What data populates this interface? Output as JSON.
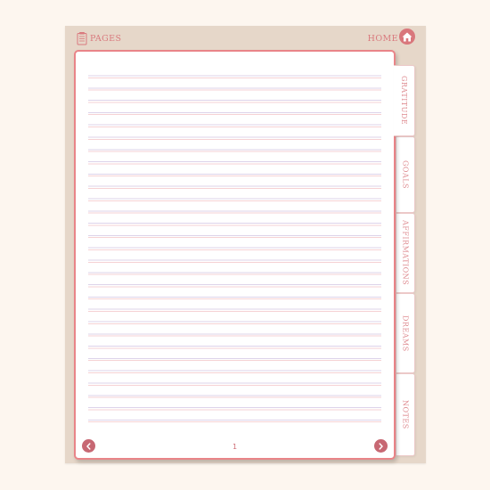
{
  "header": {
    "pages_label": "PAGES",
    "home_label": "HOME"
  },
  "page": {
    "number": "1"
  },
  "tabs": [
    {
      "label": "GRATITUDE",
      "active": true
    },
    {
      "label": "GOALS",
      "active": false
    },
    {
      "label": "AFFIRMATIONS",
      "active": false
    },
    {
      "label": "DREAMS",
      "active": false
    },
    {
      "label": "NOTES",
      "active": false
    }
  ],
  "colors": {
    "accent": "#e98488",
    "button": "#c76873",
    "frame": "#e6d7c9",
    "background": "#fdf6ef"
  },
  "icons": {
    "pages": "pages-icon",
    "home": "home-icon",
    "prev": "chevron-left-icon",
    "next": "chevron-right-icon"
  }
}
